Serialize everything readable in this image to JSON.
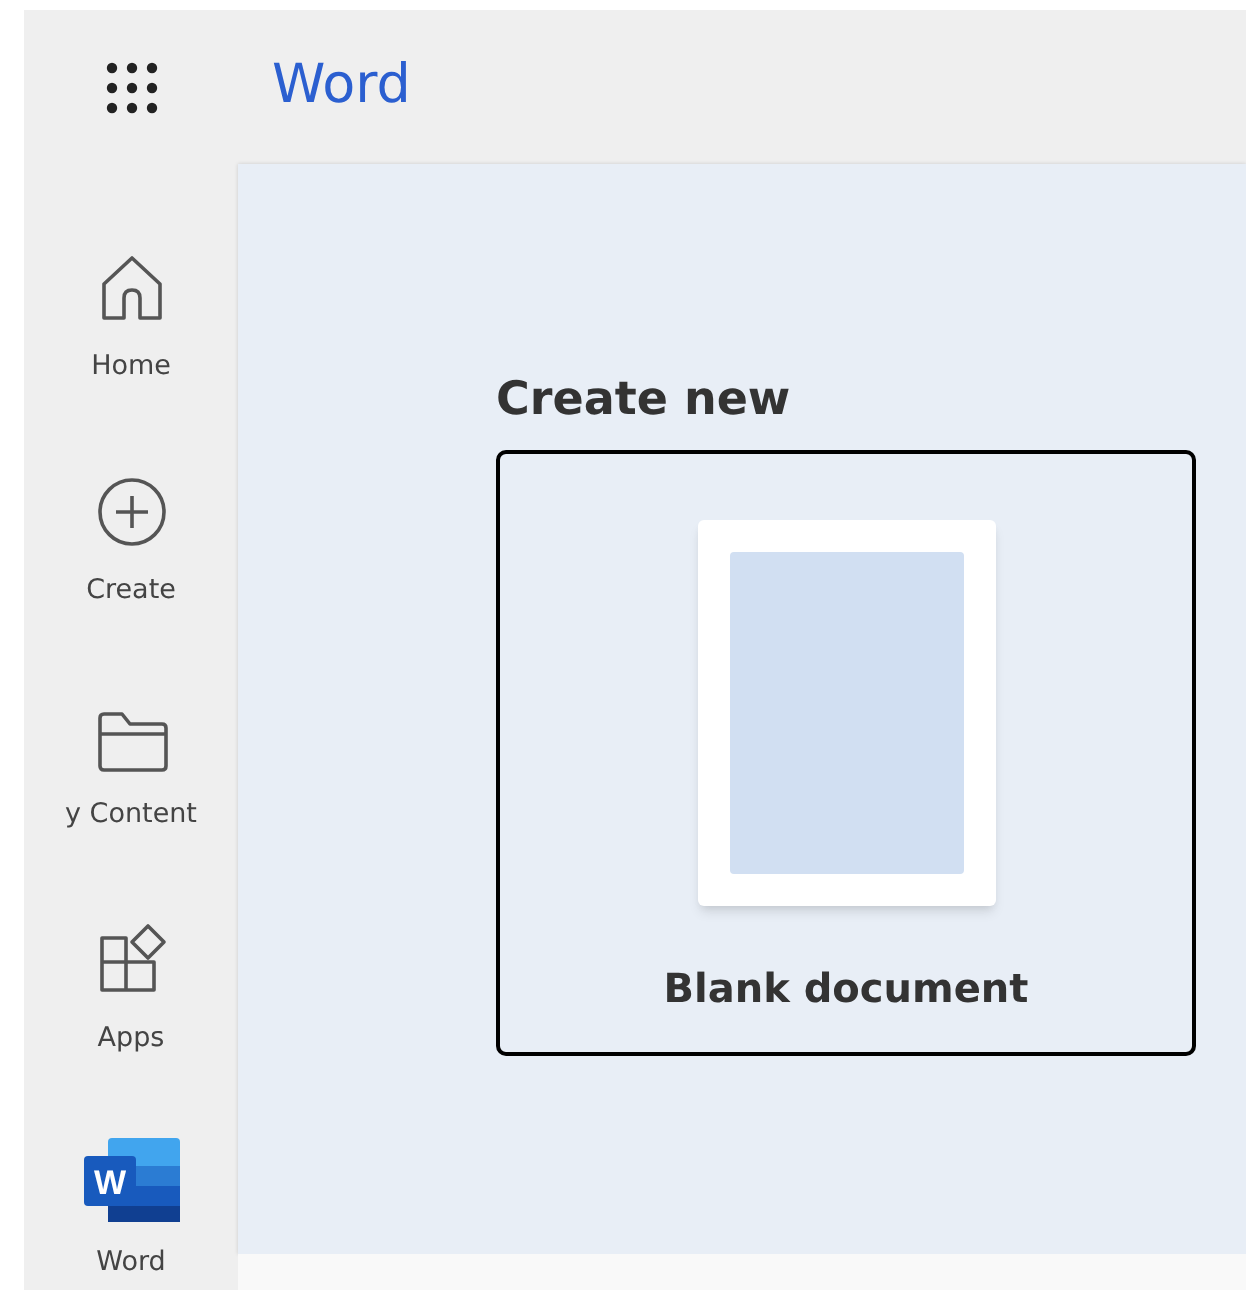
{
  "header": {
    "app_name": "Word"
  },
  "sidebar": {
    "items": [
      {
        "label": "Home",
        "kind": "home"
      },
      {
        "label": "Create",
        "kind": "create"
      },
      {
        "label": "y Content",
        "kind": "folder"
      },
      {
        "label": "Apps",
        "kind": "apps"
      },
      {
        "label": "Word",
        "kind": "word",
        "logo_letter": "W"
      }
    ]
  },
  "main": {
    "heading": "Create new",
    "templates": [
      {
        "label": "Blank document"
      }
    ]
  }
}
